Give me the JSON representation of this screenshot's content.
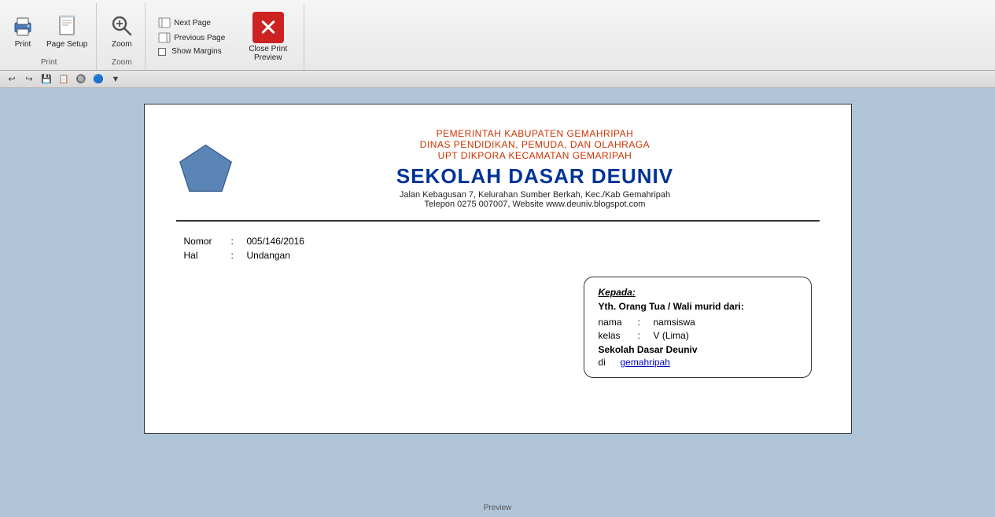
{
  "ribbon": {
    "groups": [
      {
        "name": "Print",
        "label": "Print",
        "buttons": [
          {
            "id": "print-btn",
            "label": "Print"
          },
          {
            "id": "page-setup-btn",
            "label": "Page\nSetup"
          }
        ]
      },
      {
        "name": "Zoom",
        "label": "Zoom",
        "buttons": [
          {
            "id": "zoom-btn",
            "label": "Zoom"
          }
        ]
      },
      {
        "name": "Preview",
        "label": "Preview",
        "nav_buttons": [
          {
            "id": "next-page-btn",
            "label": "Next Page"
          },
          {
            "id": "prev-page-btn",
            "label": "Previous Page"
          }
        ],
        "show_margins": "Show Margins",
        "close_label_line1": "Close Print",
        "close_label_line2": "Preview"
      }
    ]
  },
  "document": {
    "header": {
      "line1": "PEMERINTAH KABUPATEN GEMAHRIPAH",
      "line2": "DINAS PENDIDIKAN, PEMUDA, DAN OLAHRAGA",
      "line3": "UPT DIKPORA KECAMATAN GEMARIPAH",
      "school_name": "SEKOLAH DASAR DEUNIV",
      "address_line1": "Jalan Kebagusan 7, Kelurahan Sumber Berkah, Kec./Kab Gemahripah",
      "address_line2": "Telepon 0275 007007, Website www.deuniv.blogspot.com"
    },
    "fields": {
      "nomor_label": "Nomor",
      "nomor_colon": ":",
      "nomor_value": "005/146/2016",
      "hal_label": "Hal",
      "hal_colon": ":",
      "hal_value": "Undangan"
    },
    "address_box": {
      "to_label": "Kepada:",
      "yth_label": "Yth.   Orang Tua / Wali murid dari:",
      "nama_label": "nama",
      "nama_colon": ":",
      "nama_value": "namsiswa",
      "kelas_label": "kelas",
      "kelas_colon": ":",
      "kelas_value": "V (Lima)",
      "school": "Sekolah Dasar Deuniv",
      "di_label": "di",
      "di_value": "gemahripah"
    }
  }
}
